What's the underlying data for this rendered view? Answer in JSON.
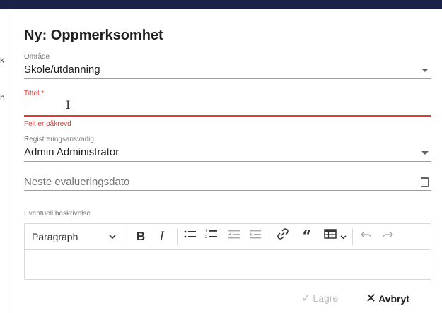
{
  "dialog": {
    "title": "Ny: Oppmerksomhet"
  },
  "fields": {
    "area": {
      "label": "Område",
      "value": "Skole/utdanning"
    },
    "title_field": {
      "label": "Tittel *",
      "value": "",
      "error": "Felt er påkrevd"
    },
    "responsible": {
      "label": "Registreringsansvarlig",
      "value": "Admin Administrator"
    },
    "next_eval": {
      "placeholder": "Neste evalueringsdato"
    },
    "description": {
      "label": "Eventuell beskrivelse"
    }
  },
  "editor": {
    "paragraph_label": "Paragraph",
    "toolbar_icons": [
      "chevron-down-icon",
      "bold-icon",
      "italic-icon",
      "bulleted-list-icon",
      "numbered-list-icon",
      "outdent-icon",
      "indent-icon",
      "link-icon",
      "blockquote-icon",
      "table-icon",
      "undo-icon",
      "redo-icon"
    ]
  },
  "buttons": {
    "save": "Lagre",
    "cancel": "Avbryt"
  },
  "colors": {
    "error": "#e53935",
    "topbar": "#1a2347"
  }
}
